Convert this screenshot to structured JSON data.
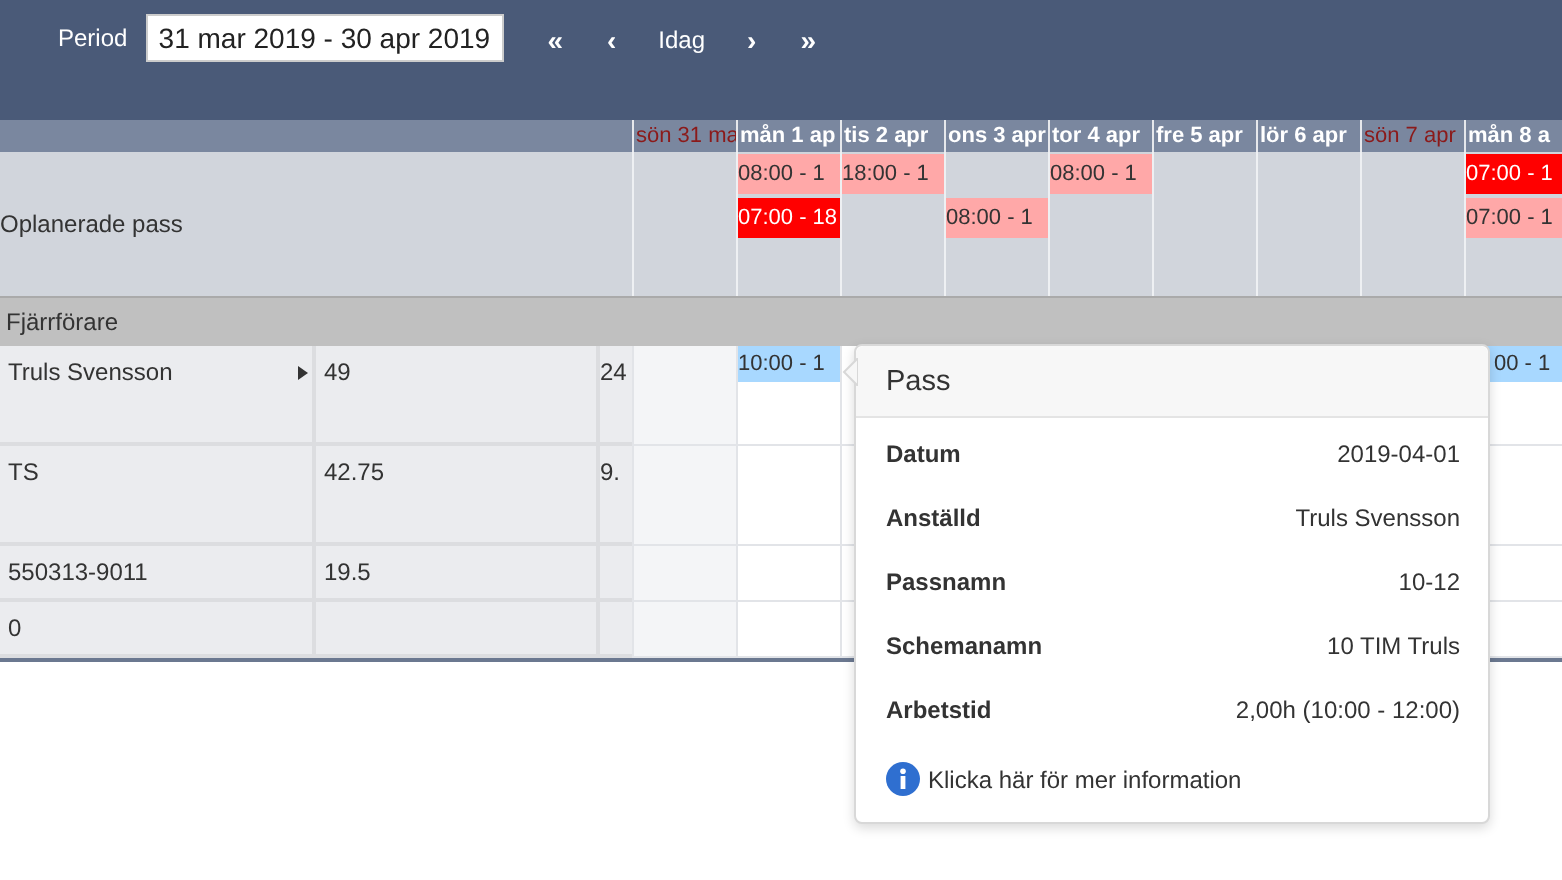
{
  "toolbar": {
    "period_label": "Period",
    "period_value": "31 mar 2019 - 30 apr 2019",
    "nav": [
      {
        "kind": "first",
        "label": "«"
      },
      {
        "kind": "prev",
        "label": "‹"
      },
      {
        "kind": "today",
        "label": "Idag"
      },
      {
        "kind": "next",
        "label": "›"
      },
      {
        "kind": "last",
        "label": "»"
      }
    ]
  },
  "unplanned_label": "Oplanerade pass",
  "days": [
    {
      "label": "sön 31 ma",
      "weekend": true
    },
    {
      "label": "mån 1 ap",
      "weekend": false,
      "upper": {
        "time": "08:00 - 1",
        "color": "#ffa8a8"
      },
      "lower": {
        "time": "07:00 - 18",
        "color": "#ff0000"
      },
      "shift": {
        "time": "10:00 - 1",
        "color": "#a8d8ff"
      }
    },
    {
      "label": "tis 2 apr",
      "weekend": false,
      "upper": {
        "time": "18:00 - 1",
        "color": "#ffa8a8"
      }
    },
    {
      "label": "ons 3 apr",
      "weekend": false,
      "lower": {
        "time": "08:00 - 1",
        "color": "#ffa8a8"
      }
    },
    {
      "label": "tor 4 apr",
      "weekend": false,
      "upper": {
        "time": "08:00 - 1",
        "color": "#ffa8a8"
      }
    },
    {
      "label": "fre 5 apr",
      "weekend": false
    },
    {
      "label": "lör 6 apr",
      "weekend": false
    },
    {
      "label": "sön 7 apr",
      "weekend": true
    },
    {
      "label": "mån 8 a",
      "weekend": false,
      "upper": {
        "time": "07:00 - 1",
        "color": "#ff0000"
      },
      "lower": {
        "time": "07:00 - 1",
        "color": "#ffa8a8"
      },
      "shift": {
        "time": "00 - 1",
        "color": "#a8d8ff"
      }
    }
  ],
  "group": "Fjärrförare",
  "rows": [
    {
      "cells": [
        "Truls Svensson",
        "49",
        "24"
      ],
      "expandable": true,
      "tall": true
    },
    {
      "cells": [
        "TS",
        "42.75",
        "9."
      ],
      "expandable": false,
      "tall": true
    },
    {
      "cells": [
        "550313-9011",
        "19.5"
      ],
      "expandable": false,
      "tall": false
    },
    {
      "cells": [
        "0"
      ],
      "expandable": false,
      "tall": false
    }
  ],
  "tooltip": {
    "title": "Pass",
    "fields": [
      {
        "label": "Datum",
        "value": "2019-04-01"
      },
      {
        "label": "Anställd",
        "value": "Truls Svensson"
      },
      {
        "label": "Passnamn",
        "value": "10-12"
      },
      {
        "label": "Schemanamn",
        "value": "10 TIM Truls"
      },
      {
        "label": "Arbetstid",
        "value": "2,00h (10:00 - 12:00)"
      }
    ],
    "link": "Klicka här för mer information"
  }
}
